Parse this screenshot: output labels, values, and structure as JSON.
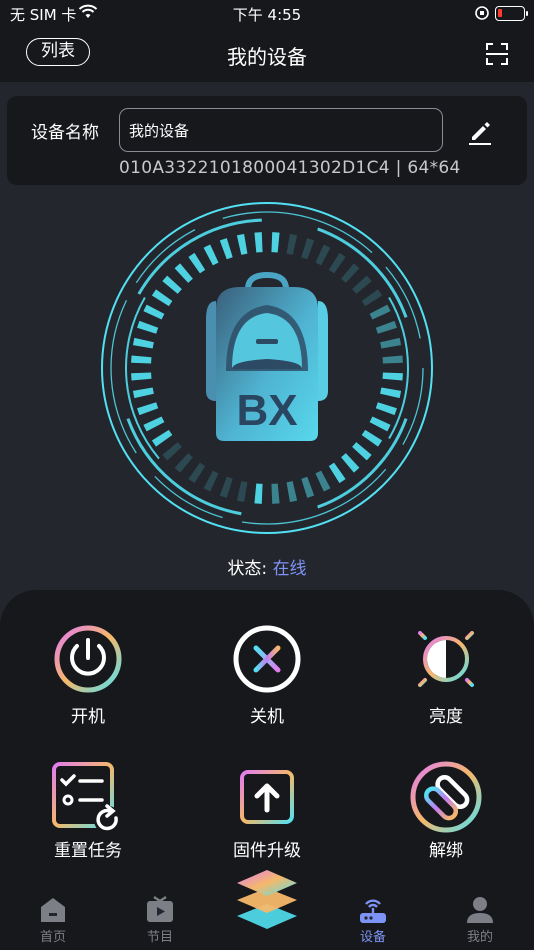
{
  "status_bar": {
    "carrier": "无 SIM 卡",
    "time": "下午 4:55"
  },
  "navbar": {
    "list_label": "列表",
    "title": "我的设备"
  },
  "device": {
    "name_label": "设备名称",
    "name_value": "我的设备",
    "serial": "010A3322101800041302D1C4  |  64*64",
    "logo_text": "BX"
  },
  "status": {
    "key": "状态:",
    "value": "在线"
  },
  "functions": [
    {
      "label": "开机",
      "icon": "power-icon"
    },
    {
      "label": "关机",
      "icon": "power-off-icon"
    },
    {
      "label": "亮度",
      "icon": "brightness-icon"
    },
    {
      "label": "重置任务",
      "icon": "reset-task-icon"
    },
    {
      "label": "固件升级",
      "icon": "firmware-upgrade-icon"
    },
    {
      "label": "解绑",
      "icon": "unbind-icon"
    }
  ],
  "tabs": [
    {
      "label": "首页",
      "icon": "home-icon"
    },
    {
      "label": "节目",
      "icon": "tv-icon"
    },
    {
      "label": "",
      "icon": "layers-icon"
    },
    {
      "label": "设备",
      "icon": "router-icon"
    },
    {
      "label": "我的",
      "icon": "user-icon"
    }
  ],
  "active_tab": "设备",
  "colors": {
    "accent_cyan": "#52e1f2",
    "accent_blue": "#7d93f5",
    "gradient_pink": "#e27cf0",
    "gradient_orange": "#f5b86a",
    "background": "#24262d"
  }
}
